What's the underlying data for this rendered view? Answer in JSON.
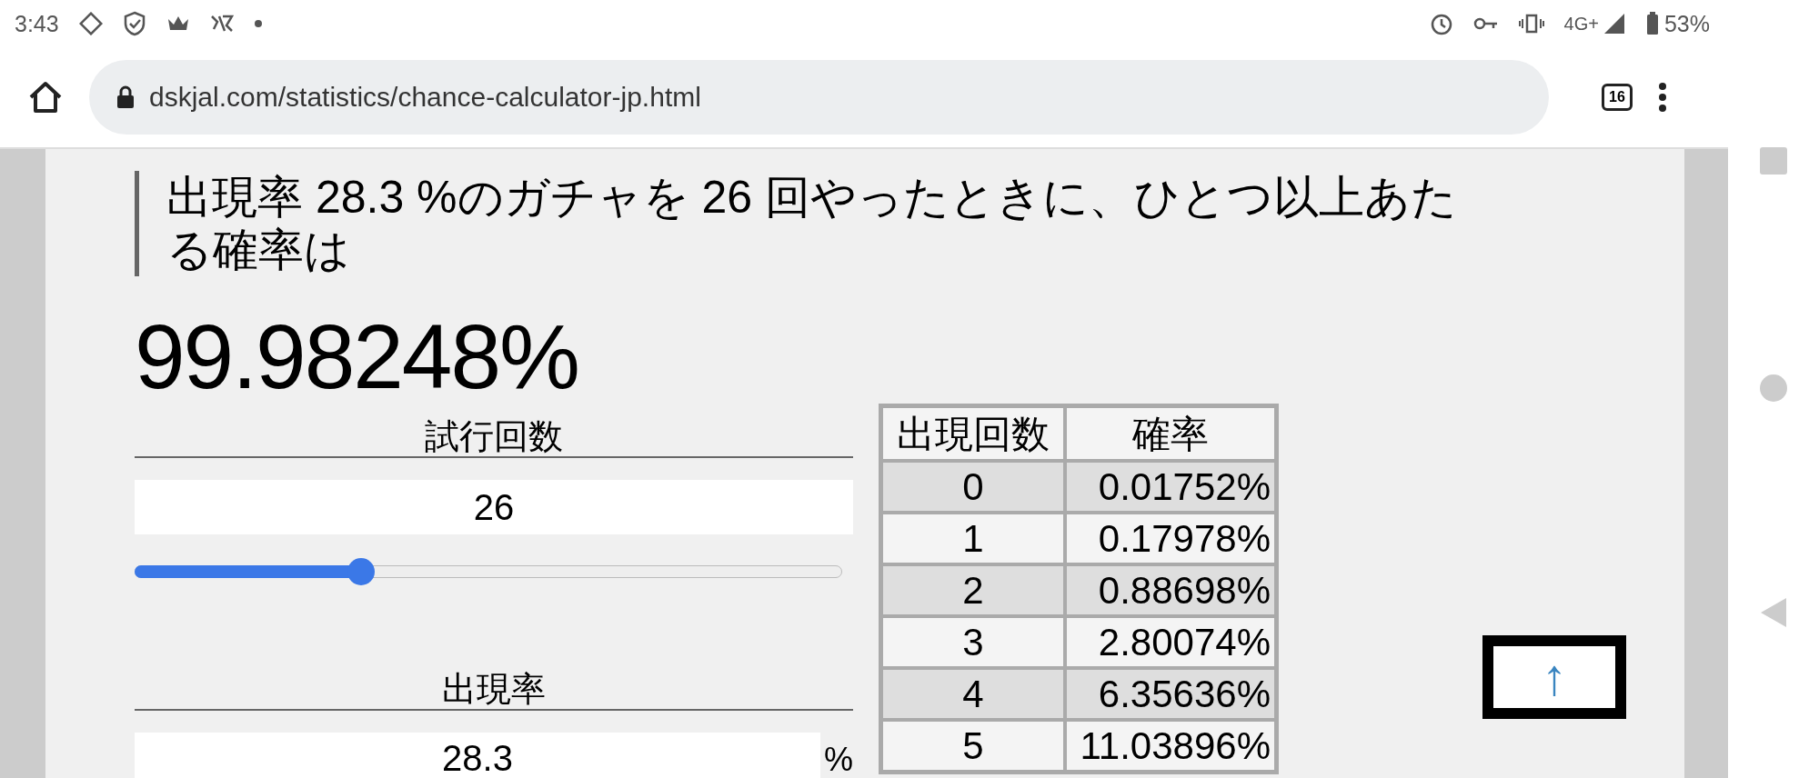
{
  "status_bar": {
    "time": "3:43",
    "network": "4G+",
    "battery": "53%"
  },
  "browser": {
    "url": "dskjal.com/statistics/chance-calculator-jp.html",
    "tab_count": "16"
  },
  "heading": "出現率 28.3 %のガチャを 26 回やったときに、ひとつ以上あたる確率は",
  "result": "99.98248%",
  "trials": {
    "label": "試行回数",
    "value": "26",
    "level": 0.32
  },
  "rate": {
    "label": "出現率",
    "value": "28.3",
    "unit": "%"
  },
  "table": {
    "columns": [
      "出現回数",
      "確率"
    ],
    "rows": [
      [
        "0",
        "0.01752%"
      ],
      [
        "1",
        "0.17978%"
      ],
      [
        "2",
        "0.88698%"
      ],
      [
        "3",
        "2.80074%"
      ],
      [
        "4",
        "6.35636%"
      ],
      [
        "5",
        "11.03896%"
      ]
    ]
  },
  "scroll_top": {
    "label": "↑"
  }
}
